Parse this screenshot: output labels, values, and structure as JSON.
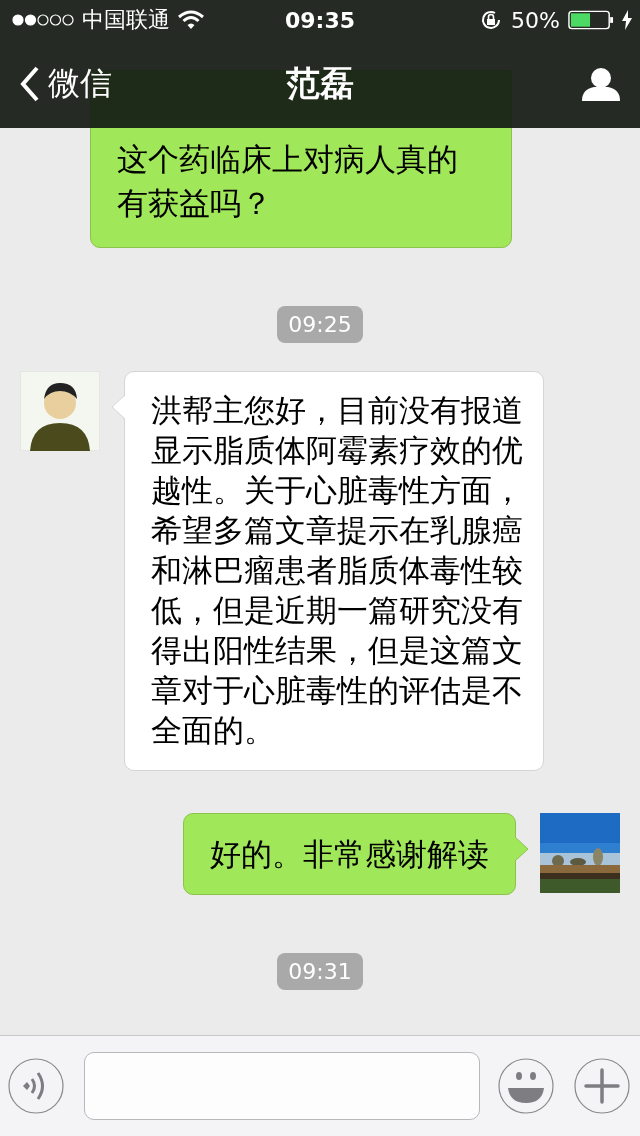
{
  "status_bar": {
    "carrier": "中国联通",
    "time": "09:35",
    "battery": "50%"
  },
  "nav": {
    "back": "微信",
    "title": "范磊"
  },
  "messages": [
    {
      "kind": "sent",
      "text": "这个药临床上对病人真的有获益吗？"
    },
    {
      "kind": "time",
      "text": "09:25"
    },
    {
      "kind": "received",
      "text": "洪帮主您好，目前没有报道显示脂质体阿霉素疗效的优越性。关于心脏毒性方面，希望多篇文章提示在乳腺癌和淋巴瘤患者脂质体毒性较低，但是近期一篇研究没有得出阳性结果，但是这篇文章对于心脏毒性的评估是不全面的。"
    },
    {
      "kind": "sent",
      "text": "好的。非常感谢解读"
    },
    {
      "kind": "time",
      "text": "09:31"
    }
  ]
}
